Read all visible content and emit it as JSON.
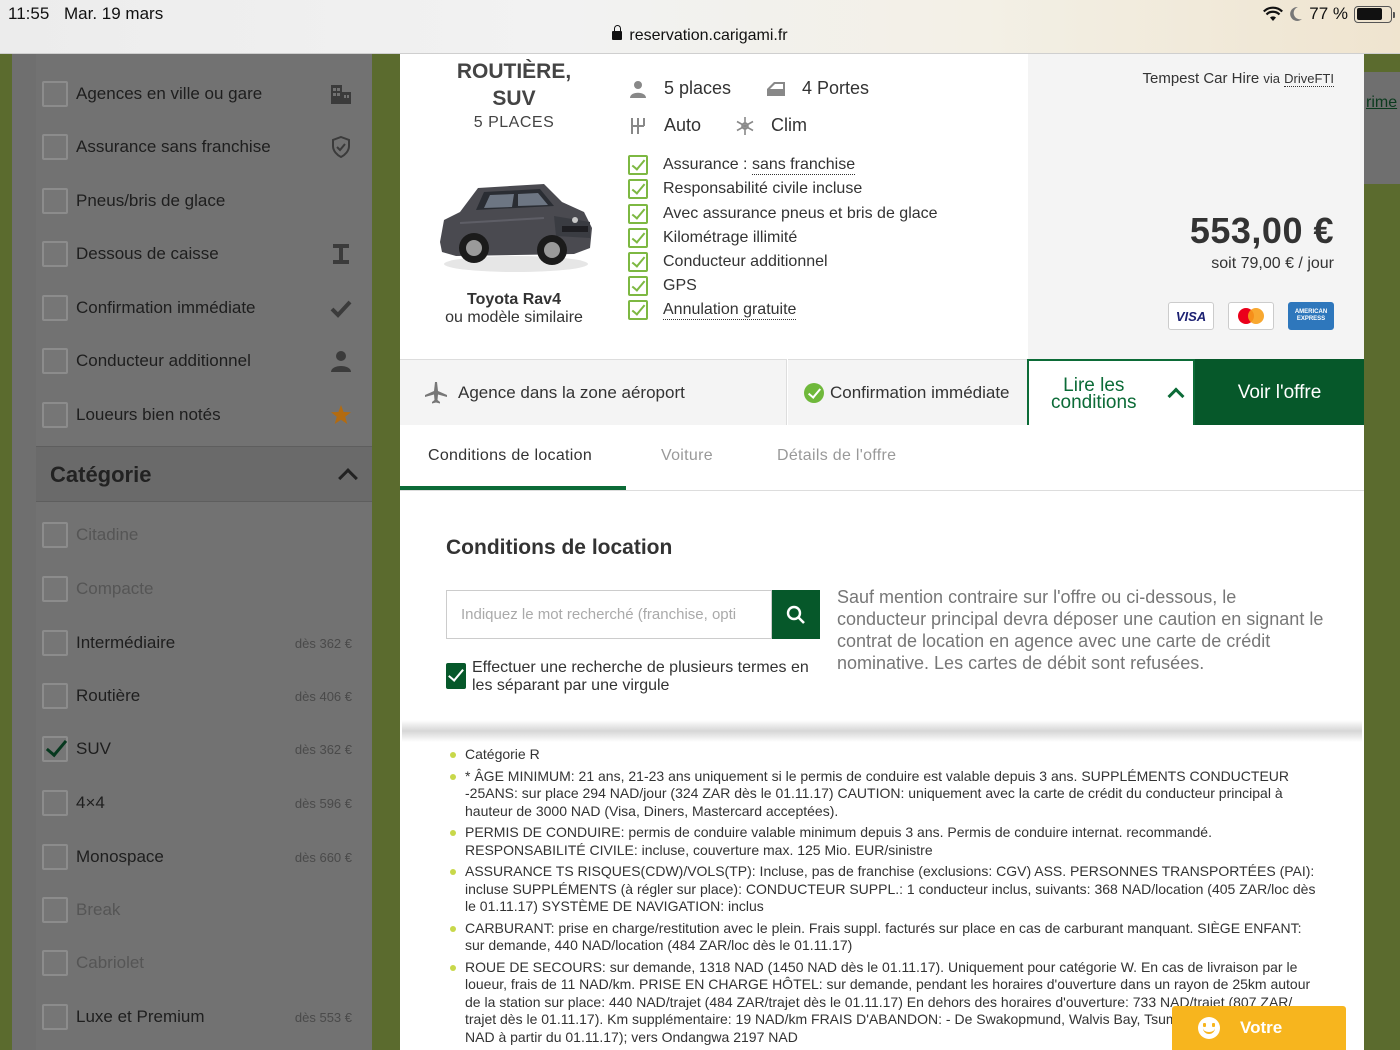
{
  "status_bar": {
    "time": "11:55",
    "date": "Mar. 19 mars",
    "url": "reservation.carigami.fr",
    "battery": "77 %"
  },
  "sidebar": {
    "options": [
      {
        "label": "Agences en ville ou gare",
        "icon": "building-icon"
      },
      {
        "label": "Assurance sans franchise",
        "icon": "shield-icon"
      },
      {
        "label": "Pneus/bris de glace",
        "icon": ""
      },
      {
        "label": "Dessous de caisse",
        "icon": "underbody-icon"
      },
      {
        "label": "Confirmation immédiate",
        "icon": "checkmark-icon"
      },
      {
        "label": "Conducteur additionnel",
        "icon": "person-icon"
      },
      {
        "label": "Loueurs bien notés",
        "icon": "star-icon"
      }
    ],
    "category_title": "Catégorie",
    "categories": [
      {
        "label": "Citadine",
        "price": "",
        "checked": false,
        "disabled": true
      },
      {
        "label": "Compacte",
        "price": "",
        "checked": false,
        "disabled": true
      },
      {
        "label": "Intermédiaire",
        "price": "dès 362 €",
        "checked": false,
        "disabled": false
      },
      {
        "label": "Routière",
        "price": "dès 406 €",
        "checked": false,
        "disabled": false
      },
      {
        "label": "SUV",
        "price": "dès 362 €",
        "checked": true,
        "disabled": false
      },
      {
        "label": "4×4",
        "price": "dès 596 €",
        "checked": false,
        "disabled": false
      },
      {
        "label": "Monospace",
        "price": "dès 660 €",
        "checked": false,
        "disabled": false
      },
      {
        "label": "Break",
        "price": "",
        "checked": false,
        "disabled": true
      },
      {
        "label": "Cabriolet",
        "price": "",
        "checked": false,
        "disabled": true
      },
      {
        "label": "Luxe et Premium",
        "price": "dès 553 €",
        "checked": false,
        "disabled": false
      }
    ]
  },
  "right_fragment": "rime",
  "offer": {
    "category_line1": "ROUTIÈRE,",
    "category_line2": "SUV",
    "places_caption": "5 PLACES",
    "model": "Toyota Rav4",
    "similar": "ou modèle similaire",
    "specs": {
      "seats": "5 places",
      "doors": "4 Portes",
      "transmission": "Auto",
      "aircon": "Clim"
    },
    "features": {
      "insurance_prefix": "Assurance : ",
      "insurance_link": "sans franchise",
      "liability": "Responsabilité civile incluse",
      "tyres": "Avec assurance pneus et bris de glace",
      "mileage": "Kilométrage illimité",
      "driver": "Conducteur additionnel",
      "gps": "GPS",
      "cancel": "Annulation gratuite"
    },
    "supplier": "Tempest Car Hire",
    "via": "via",
    "broker": "DriveFTI",
    "price": "553,00 €",
    "per_day": "soit 79,00 € / jour",
    "payment_cards": {
      "visa": "VISA",
      "amex": "AMERICAN EXPRESS"
    }
  },
  "action_bar": {
    "agency": "Agence dans la zone aéroport",
    "confirmation": "Confirmation immédiate",
    "conditions_line1": "Lire les",
    "conditions_line2": "conditions",
    "offer_button": "Voir l'offre"
  },
  "tabs": [
    "Conditions de location",
    "Voiture",
    "Détails de l'offre"
  ],
  "conditions": {
    "title": "Conditions de location",
    "search_placeholder": "Indiquez le mot recherché (franchise, opti",
    "multi_search_label": "Effectuer une recherche de plusieurs termes en les séparant par une virgule",
    "note": "Sauf mention contraire sur l'offre ou ci-dessous, le conducteur principal devra déposer une caution en signant le contrat de location en agence avec une carte de crédit nominative. Les cartes de débit sont refusées.",
    "rules": [
      "Catégorie R",
      "* ÂGE MINIMUM: 21 ans, 21-23 ans uniquement si le permis de conduire est valable depuis 3 ans. SUPPLÉMENTS CONDUCTEUR -25ANS: sur place 294 NAD/jour (324 ZAR dès le 01.11.17) CAUTION: uniquement avec la carte de crédit du conducteur principal à hauteur de 3000 NAD (Visa, Diners, Mastercard acceptées).",
      "PERMIS DE CONDUIRE: permis de conduire valable minimum depuis 3 ans. Permis de conduire internat. recommandé. RESPONSABILITÉ CIVILE: incluse, couverture max. 125 Mio. EUR/sinistre",
      "ASSURANCE TS RISQUES(CDW)/VOLS(TP): Incluse, pas de franchise (exclusions: CGV) ASS. PERSONNES TRANSPORTÉES (PAI): incluse SUPPLÉMENTS (à régler sur place): CONDUCTEUR SUPPL.: 1 conducteur inclus, suivants: 368 NAD/location (405 ZAR/loc dès le 01.11.17) SYSTÈME DE NAVIGATION: inclus",
      "CARBURANT: prise en charge/restitution avec le plein. Frais suppl. facturés sur place en cas de carburant manquant. SIÈGE ENFANT: sur demande, 440 NAD/location (484 ZAR/loc dès le 01.11.17)",
      "ROUE DE SECOURS: sur demande, 1318 NAD (1450 NAD dès le 01.11.17). Uniquement pour catégorie W. En cas de livraison par le loueur, frais de 11 NAD/km. PRISE EN CHARGE HÔTEL: sur demande, pendant les horaires d'ouverture dans un rayon de 25km autour de la station sur place: 440 NAD/trajet (484 ZAR/trajet dès le 01.11.17) En dehors des horaires d'ouverture: 733 NAD/trajet (807 ZAR/ trajet dès le 01.11.17). Km supplémentaire: 19 NAD/km FRAIS D'ABANDON: - De Swakopmund, Walvis Bay, Tsumeb 1465 NAD, (1612 NAD à partir du 01.11.17); vers Ondangwa 2197 NAD"
    ]
  },
  "chat": {
    "label": "Votre"
  },
  "colors": {
    "brand_green": "#06582a",
    "accent_lime": "#7db842",
    "chat_yellow": "#f7b51e"
  }
}
